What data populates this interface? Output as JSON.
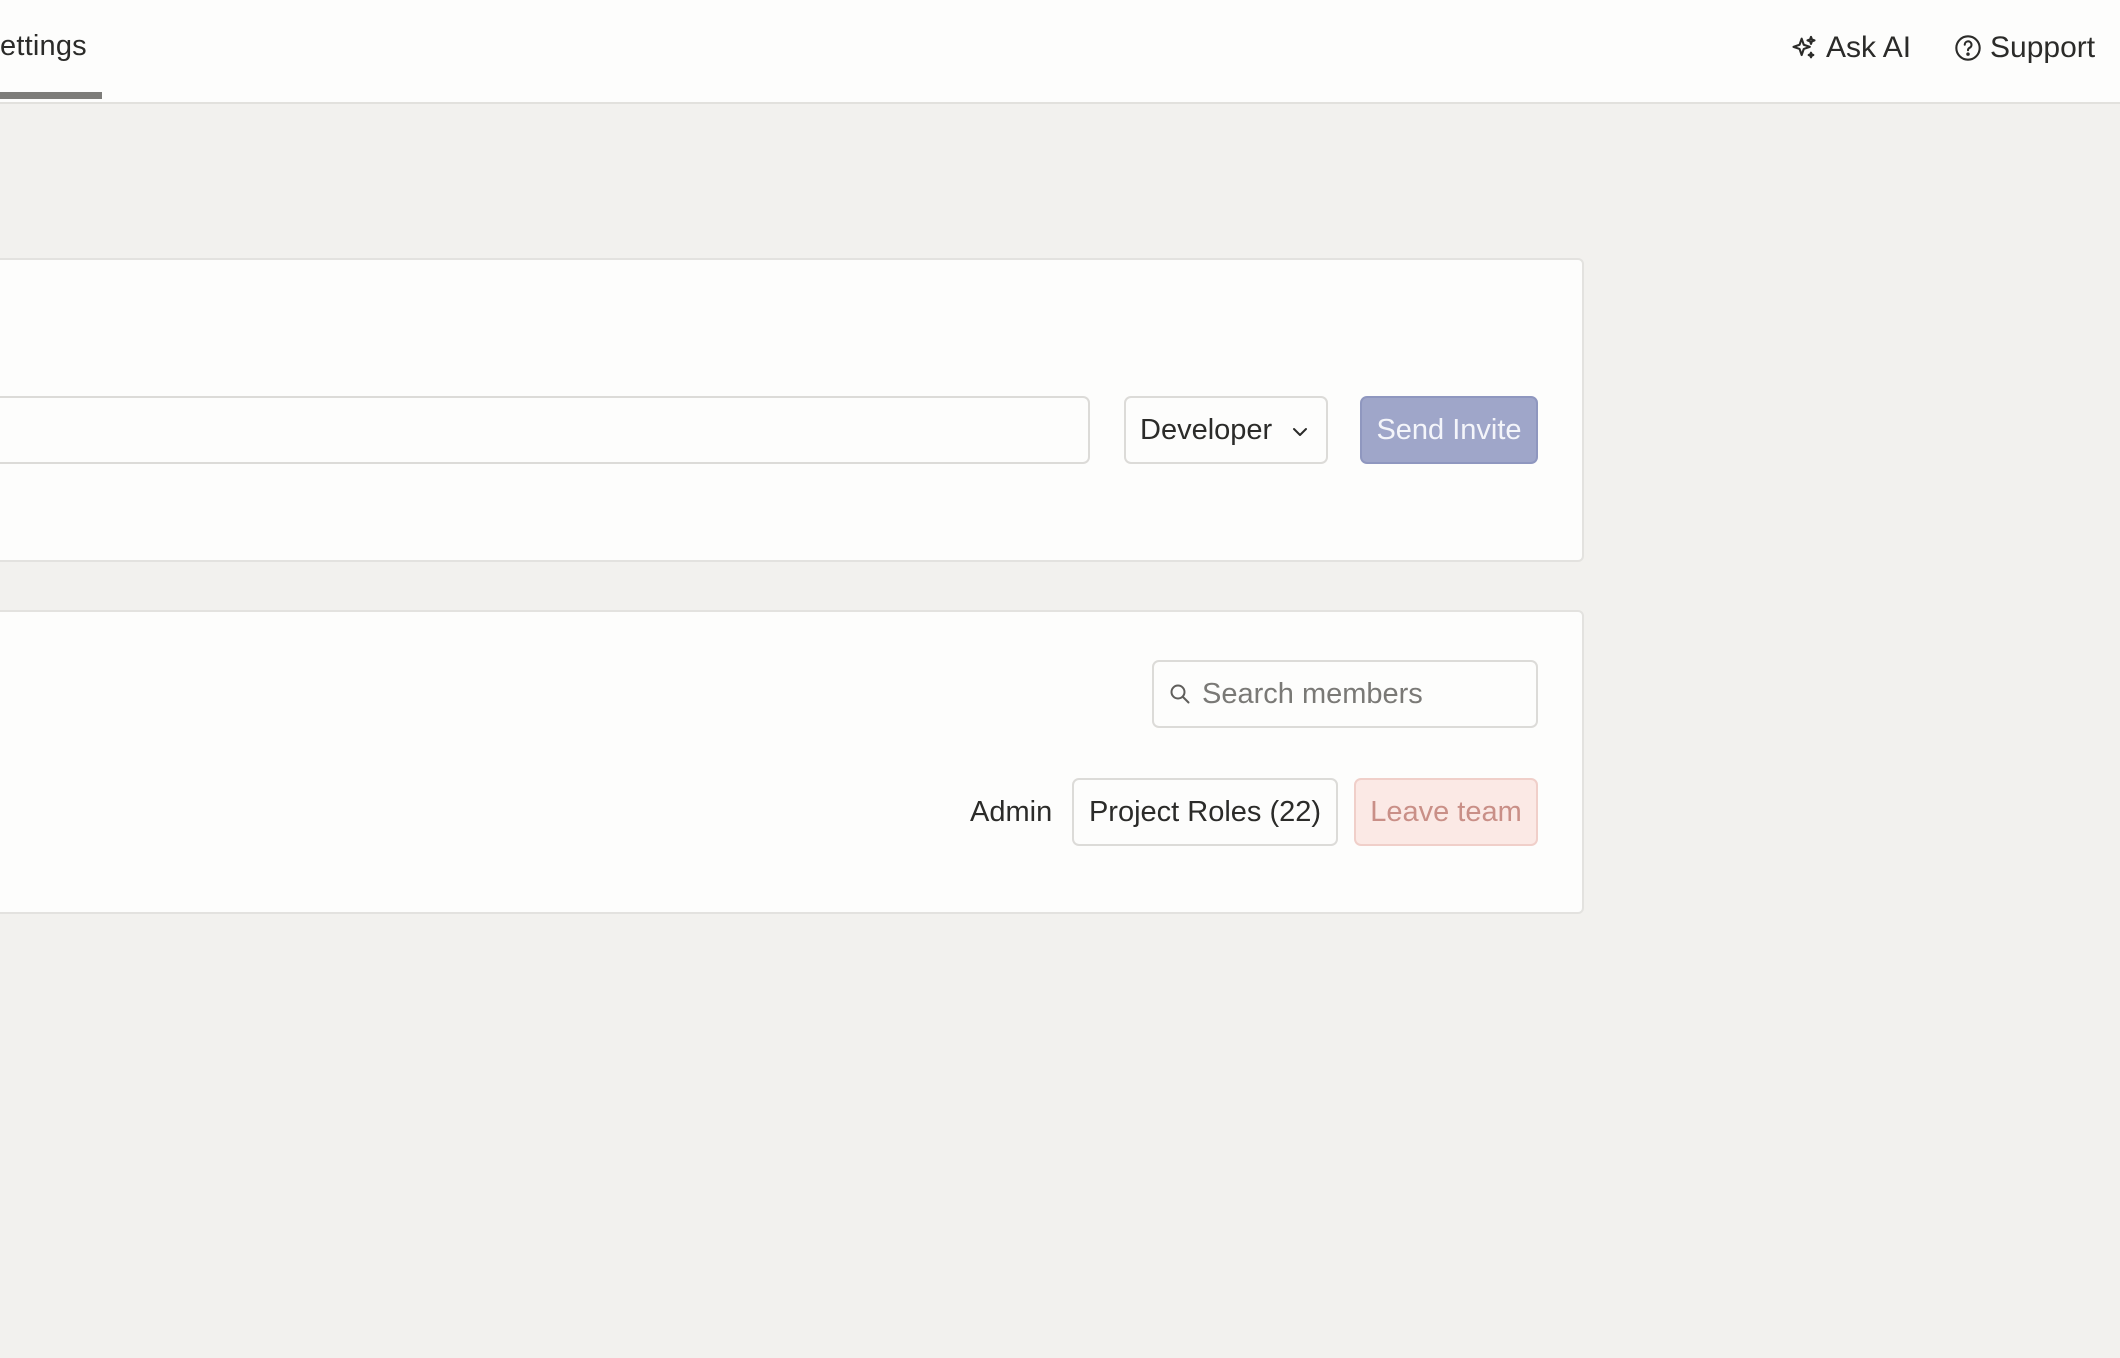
{
  "header": {
    "active_tab_label": "ettings",
    "ask_ai_label": "Ask AI",
    "support_label": "Support",
    "ask_ai_icon": "sparkle-icon",
    "support_icon": "help-circle-icon"
  },
  "invite": {
    "email_value": "",
    "role_selected": "Developer",
    "send_label": "Send Invite"
  },
  "members": {
    "search_placeholder": "Search members",
    "search_value": "",
    "rows": [
      {
        "role": "Admin",
        "project_roles_label": "Project Roles (22)",
        "leave_label": "Leave team"
      }
    ]
  },
  "colors": {
    "primary_button_disabled": "#9fa6c9",
    "danger_soft_bg": "#fbe9e5",
    "danger_soft_text": "#c98f87",
    "page_bg": "#f2f1ee"
  }
}
